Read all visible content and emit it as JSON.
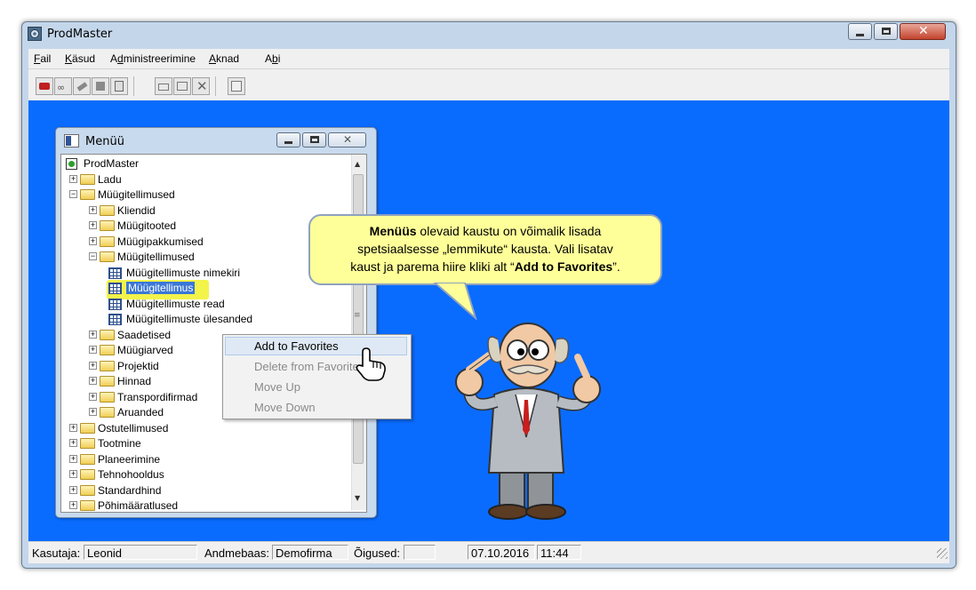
{
  "window": {
    "title": "ProdMaster"
  },
  "menubar": {
    "items": [
      {
        "pre": "",
        "u": "F",
        "post": "ail"
      },
      {
        "pre": "",
        "u": "K",
        "post": "äsud"
      },
      {
        "pre": "A",
        "u": "d",
        "post": "ministreerimine"
      },
      {
        "pre": "",
        "u": "A",
        "post": "knad"
      },
      {
        "pre": "A",
        "u": "b",
        "post": "i"
      }
    ]
  },
  "menu_window": {
    "title": "Menüü",
    "tree": [
      {
        "label": "ProdMaster",
        "type": "root"
      },
      {
        "label": "Ladu",
        "type": "folder"
      },
      {
        "label": "Müügitellimused",
        "type": "folder-open"
      },
      {
        "label": "Kliendid",
        "type": "folder"
      },
      {
        "label": "Müügitooted",
        "type": "folder"
      },
      {
        "label": "Müügipakkumised",
        "type": "folder"
      },
      {
        "label": "Müügitellimused",
        "type": "folder-open"
      },
      {
        "label": "Müügitellimuste nimekiri",
        "type": "grid"
      },
      {
        "label": "Müügitellimus",
        "type": "form"
      },
      {
        "label": "Müügitellimuste read",
        "type": "grid"
      },
      {
        "label": "Müügitellimuste ülesanded",
        "type": "grid"
      },
      {
        "label": "Saadetised",
        "type": "folder"
      },
      {
        "label": "Müügiarved",
        "type": "folder"
      },
      {
        "label": "Projektid",
        "type": "folder"
      },
      {
        "label": "Hinnad",
        "type": "folder"
      },
      {
        "label": "Transpordifirmad",
        "type": "folder"
      },
      {
        "label": "Aruanded",
        "type": "folder"
      },
      {
        "label": "Ostutellimused",
        "type": "folder"
      },
      {
        "label": "Tootmine",
        "type": "folder"
      },
      {
        "label": "Planeerimine",
        "type": "folder"
      },
      {
        "label": "Tehnohooldus",
        "type": "folder"
      },
      {
        "label": "Standardhind",
        "type": "folder"
      },
      {
        "label": "Põhimäärat­lused",
        "type": "folder"
      }
    ]
  },
  "context_menu": {
    "items": [
      "Add to Favorites",
      "Delete from Favorites",
      "Move Up",
      "Move Down"
    ]
  },
  "bubble": {
    "bold1": "Menüüs",
    "text1": " olevaid kaustu on võimalik lisada",
    "text2": "spetsiaalsesse „lemmikute“ kausta.  Vali lisatav",
    "text3": "kaust ja parema hiire kliki alt “",
    "bold2": "Add to Favorites",
    "text4": "”."
  },
  "status": {
    "user_label": "Kasutaja:",
    "user_value": "Leonid",
    "db_label": "Andmebaas:",
    "db_value": "Demofirma",
    "rights_label": "Õigused:",
    "rights_value": "",
    "date": "07.10.2016",
    "time": "11:44"
  },
  "colors": {
    "mdi_background": "#0a6cff",
    "bubble": "#ffff99",
    "selection": "#3a77d6",
    "highlight": "#f3f34a"
  }
}
